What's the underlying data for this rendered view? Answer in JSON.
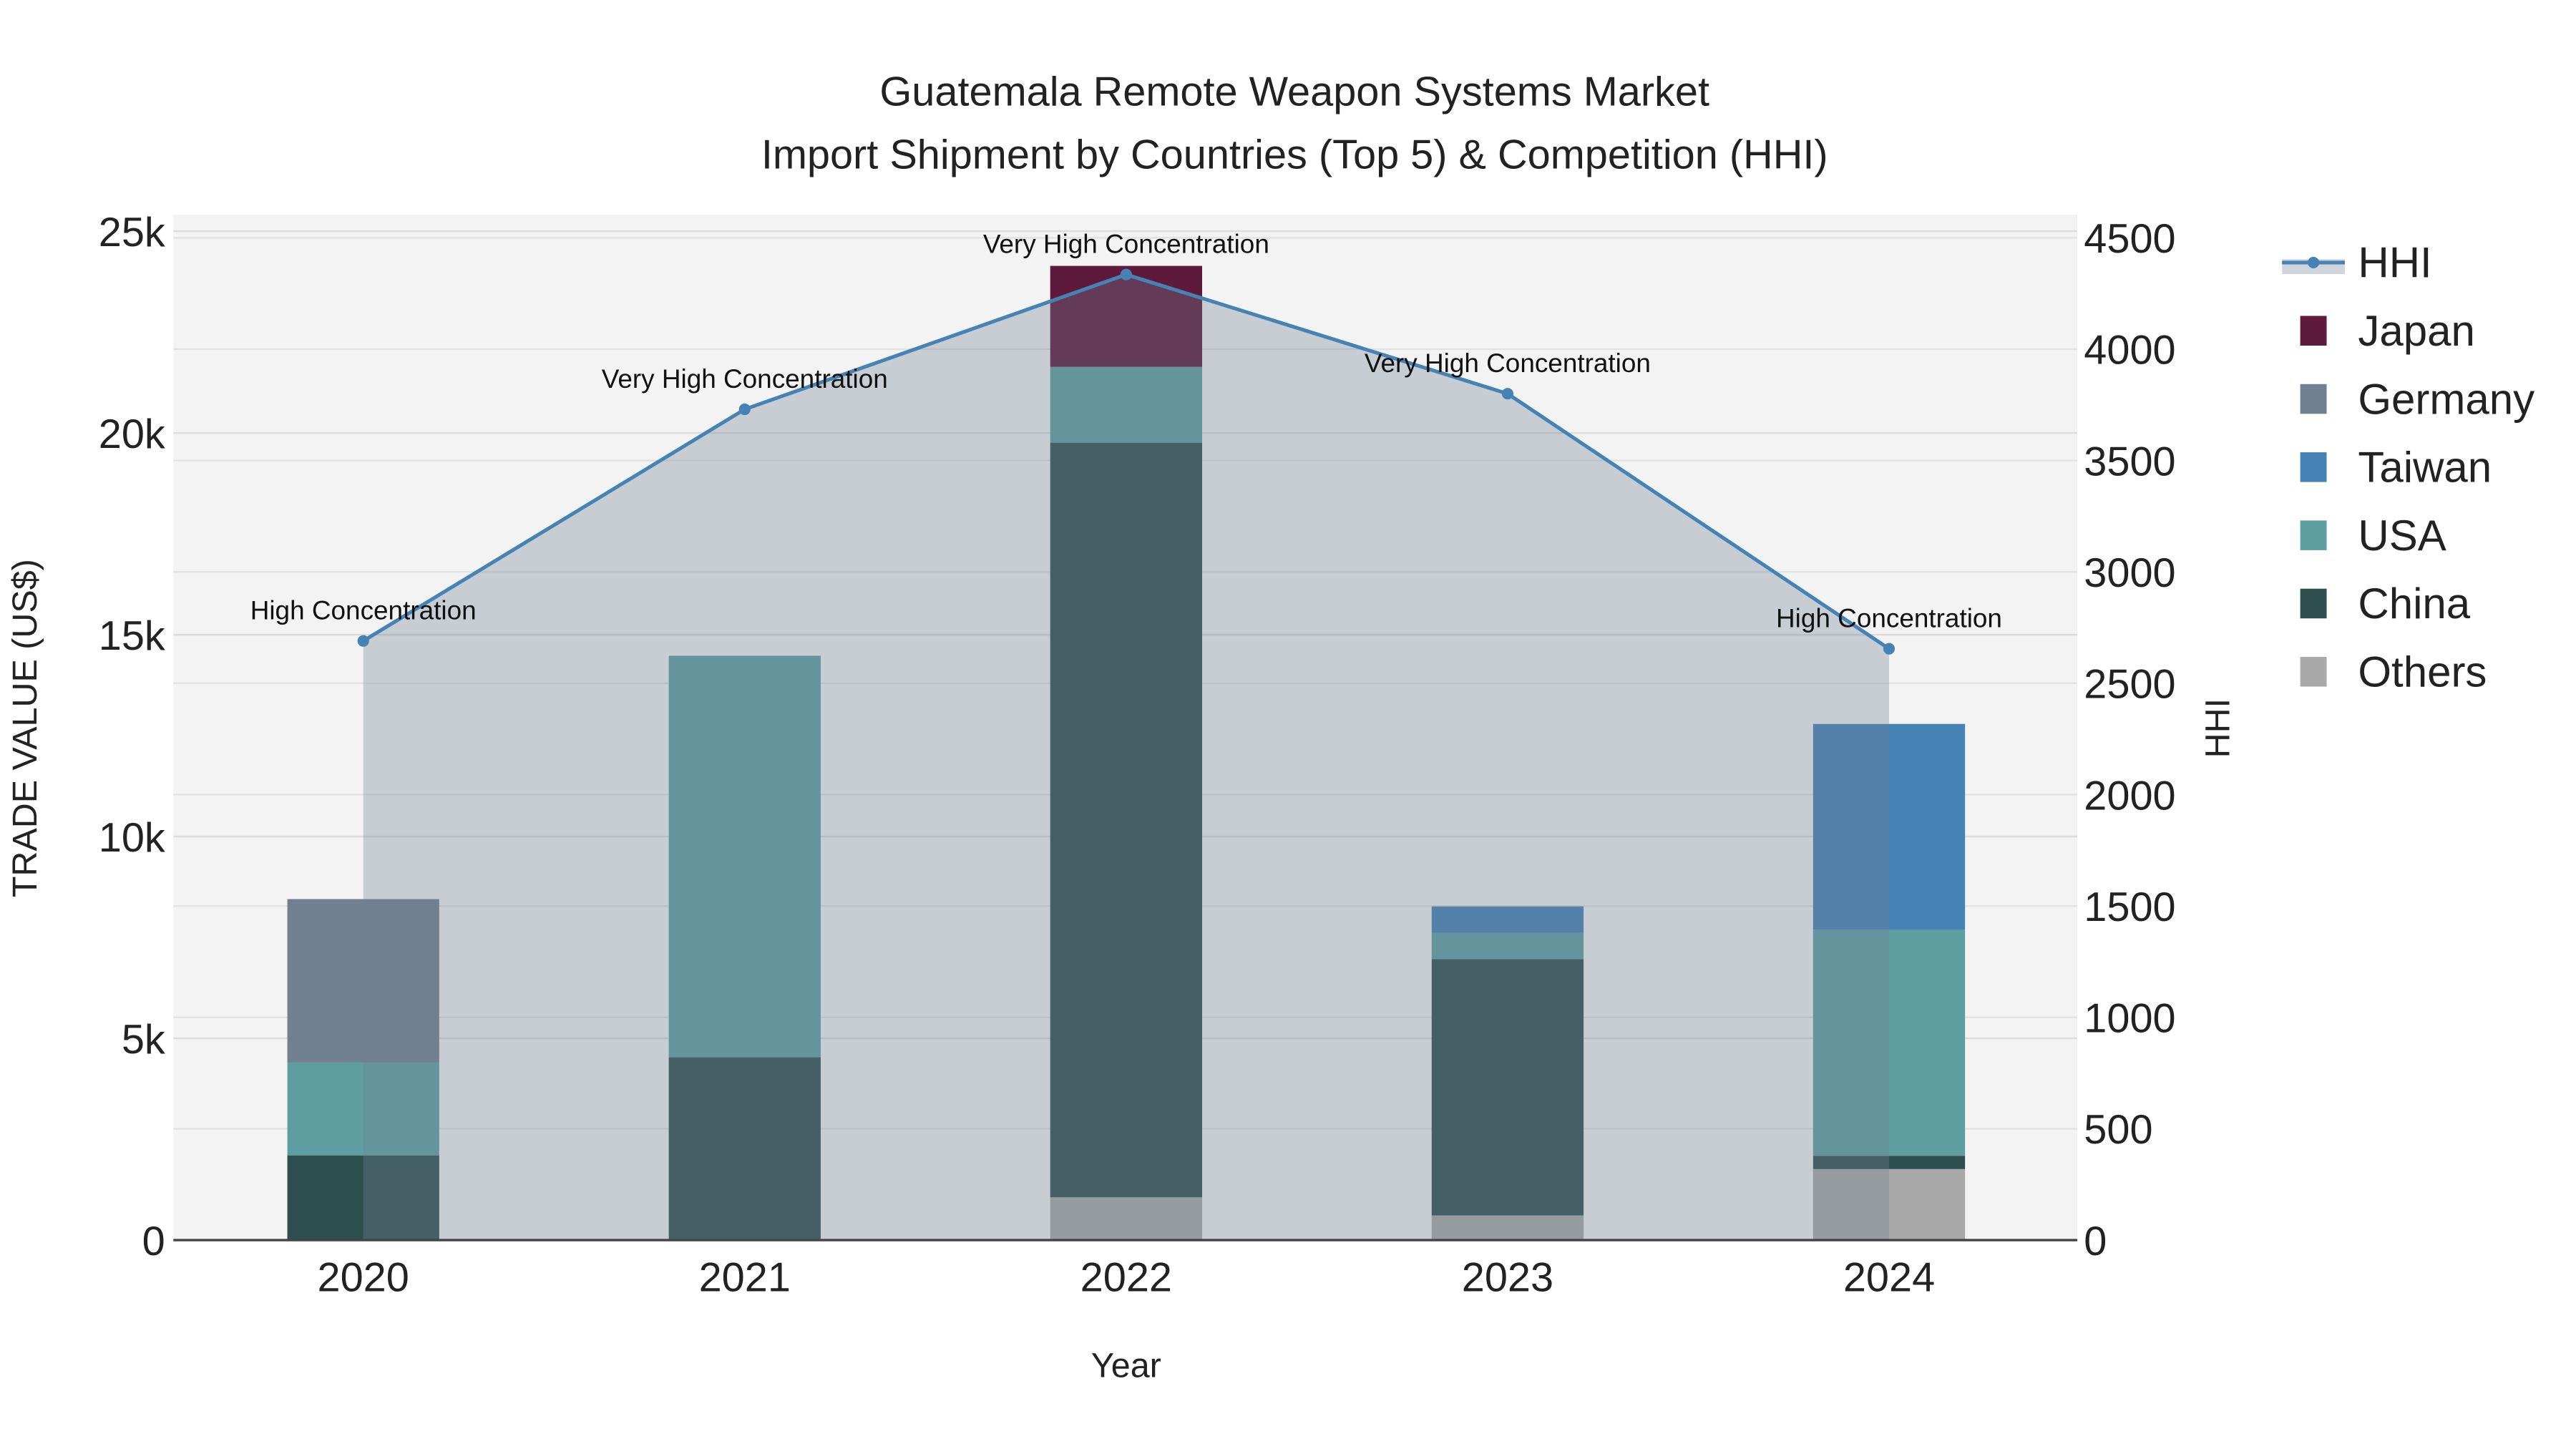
{
  "chart_data": {
    "type": "bar",
    "stacked": true,
    "title": "Guatemala Remote Weapon Systems Market",
    "subtitle": "Import Shipment by Countries (Top 5) & Competition (HHI)",
    "xlabel": "Year",
    "ylabel": "TRADE VALUE (US$)",
    "y2label": "HHI",
    "categories": [
      "2020",
      "2021",
      "2022",
      "2023",
      "2024"
    ],
    "ylim": [
      0,
      25000
    ],
    "yticks": [
      0,
      5000,
      10000,
      15000,
      20000,
      25000
    ],
    "ytick_labels": [
      "0",
      "5k",
      "10k",
      "15k",
      "20k",
      "25k"
    ],
    "y2lim": [
      0,
      4500
    ],
    "y2ticks": [
      0,
      500,
      1000,
      1500,
      2000,
      2500,
      3000,
      3500,
      4000,
      4500
    ],
    "y2tick_labels": [
      "0",
      "500",
      "1000",
      "1500",
      "2000",
      "2500",
      "3000",
      "3500",
      "4000",
      "4500"
    ],
    "grid": true,
    "legend_position": "right",
    "series": [
      {
        "name": "Others",
        "color": "#a9a9a9",
        "values": [
          0,
          30,
          1060,
          610,
          1760
        ]
      },
      {
        "name": "China",
        "color": "#2f4f4f",
        "values": [
          2100,
          4500,
          18700,
          6350,
          330
        ]
      },
      {
        "name": "USA",
        "color": "#5f9ea0",
        "values": [
          2300,
          9950,
          1880,
          650,
          5600
        ]
      },
      {
        "name": "Taiwan",
        "color": "#4682b4",
        "values": [
          0,
          0,
          0,
          660,
          5100
        ]
      },
      {
        "name": "Germany",
        "color": "#708090",
        "values": [
          4050,
          0,
          0,
          0,
          0
        ]
      },
      {
        "name": "Japan",
        "color": "#5e1a3a",
        "values": [
          0,
          0,
          2500,
          0,
          0
        ]
      }
    ],
    "legend_order": [
      "HHI",
      "Japan",
      "Germany",
      "Taiwan",
      "USA",
      "China",
      "Others"
    ],
    "hhi": {
      "name": "HHI",
      "color": "#4682b4",
      "values": [
        2690,
        3730,
        4335,
        3800,
        2655
      ],
      "annotations": [
        "High Concentration",
        "Very High Concentration",
        "Very High Concentration",
        "Very High Concentration",
        "High Concentration"
      ]
    }
  }
}
